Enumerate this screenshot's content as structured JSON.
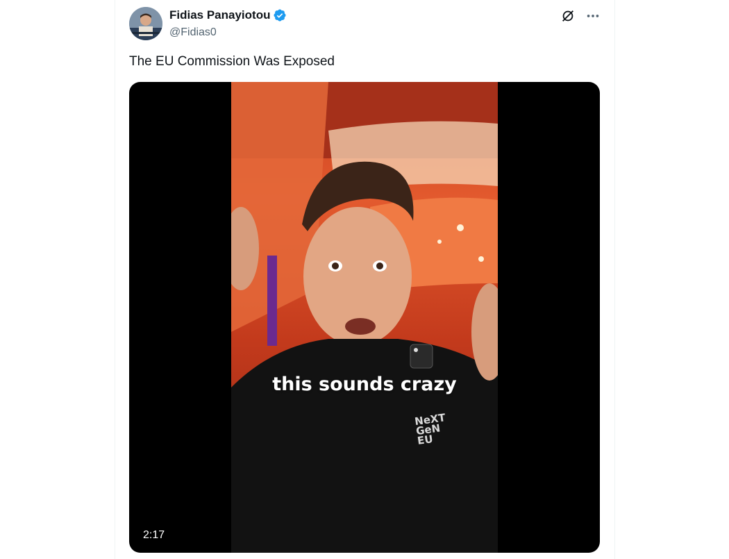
{
  "tweet": {
    "display_name": "Fidias Panayiotou",
    "handle": "@Fidias0",
    "text": "The EU Commission Was Exposed",
    "verified": true
  },
  "media": {
    "caption": "this sounds crazy",
    "duration": "2:17",
    "shirt_logo_lines": [
      "NeXT",
      "GeN",
      "EU"
    ]
  },
  "icons": {
    "grok": "grok-icon",
    "more": "more-icon",
    "verified": "verified-badge-icon"
  },
  "colors": {
    "verified_blue": "#1d9bf0",
    "secondary_text": "#536471",
    "primary_text": "#0f1419"
  }
}
